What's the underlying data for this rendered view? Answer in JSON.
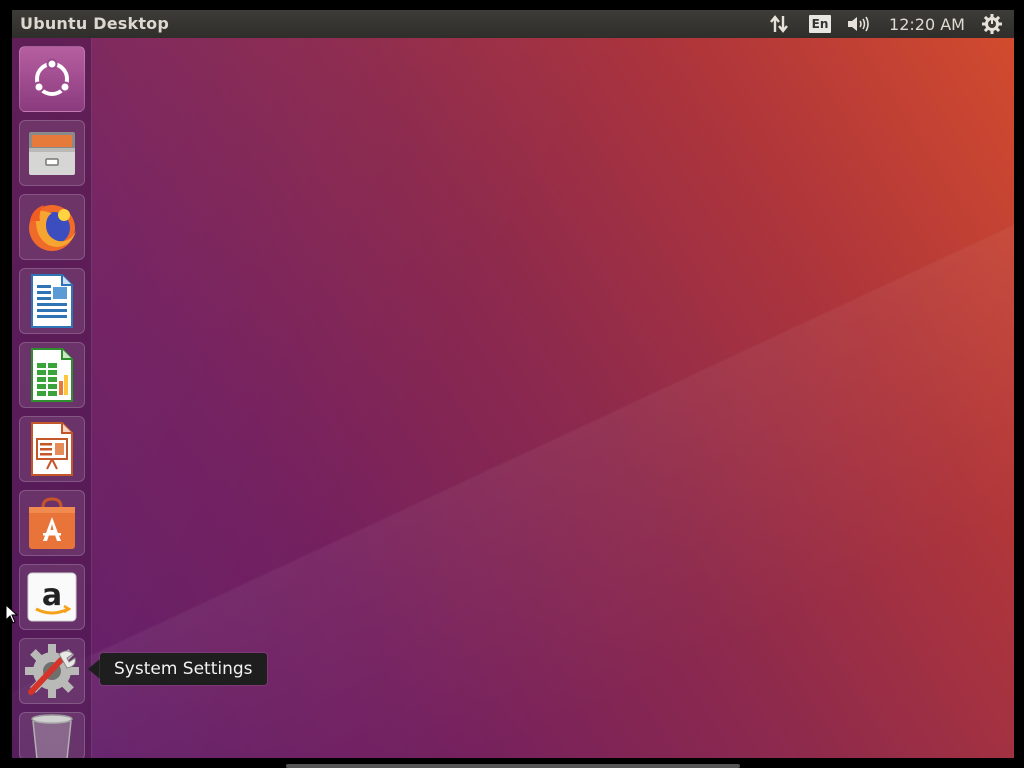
{
  "panel": {
    "title": "Ubuntu Desktop",
    "keyboard_layout": "En",
    "clock": "12:20 AM",
    "icons": {
      "network": "network-arrows-icon",
      "volume": "speaker-volume-icon",
      "session": "power-gear-icon"
    }
  },
  "launcher": {
    "items": [
      {
        "name": "Search your computer",
        "icon": "ubuntu-dash-icon"
      },
      {
        "name": "Files",
        "icon": "file-cabinet-icon"
      },
      {
        "name": "Firefox Web Browser",
        "icon": "firefox-icon"
      },
      {
        "name": "LibreOffice Writer",
        "icon": "writer-document-icon"
      },
      {
        "name": "LibreOffice Calc",
        "icon": "calc-spreadsheet-icon"
      },
      {
        "name": "LibreOffice Impress",
        "icon": "impress-presentation-icon"
      },
      {
        "name": "Ubuntu Software",
        "icon": "software-bag-icon"
      },
      {
        "name": "Amazon",
        "icon": "amazon-icon"
      },
      {
        "name": "System Settings",
        "icon": "settings-gear-wrench-icon"
      },
      {
        "name": "Trash",
        "icon": "trash-icon"
      }
    ]
  },
  "tooltip": {
    "text": "System Settings"
  },
  "colors": {
    "panel_bg": "#3a3935",
    "wallpaper_purple": "#5e1d6a",
    "wallpaper_orange": "#d24b2e",
    "tooltip_bg": "#1e1e1e"
  }
}
